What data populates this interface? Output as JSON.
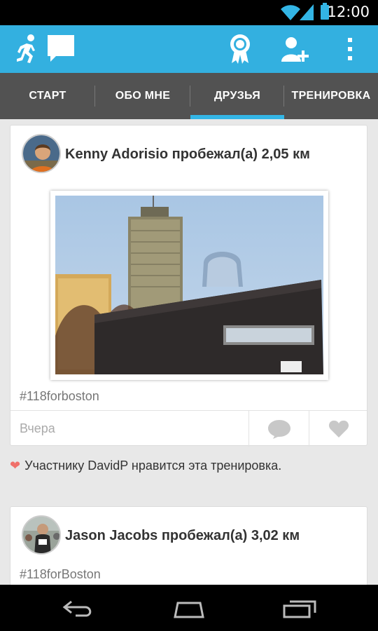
{
  "status_bar": {
    "time": "12:00",
    "icons": [
      "wifi-icon",
      "signal-icon",
      "battery-icon"
    ]
  },
  "app_bar": {
    "icons": [
      "runner-logo-icon",
      "chat-bubble-icon",
      "achievement-ribbon-icon",
      "add-friend-icon",
      "overflow-menu-icon"
    ],
    "accent_color": "#33b0e0"
  },
  "tabs": [
    {
      "label": "СТАРТ",
      "active": false
    },
    {
      "label": "ОБО МНЕ",
      "active": false
    },
    {
      "label": "ДРУЗЬЯ",
      "active": true
    },
    {
      "label": "ТРЕНИРОВКА",
      "active": false
    }
  ],
  "feed": [
    {
      "title": "Kenny Adorisio пробежал(а) 2,05 км",
      "hashtag": "#118forboston",
      "date": "Вчера",
      "like_note": "Участнику DavidP нравится эта тренировка."
    },
    {
      "title": "Jason Jacobs пробежал(а) 3,02 км",
      "hashtag": "#118forBoston"
    }
  ],
  "nav_bar": {
    "icons": [
      "back-icon",
      "home-icon",
      "recent-apps-icon"
    ]
  }
}
